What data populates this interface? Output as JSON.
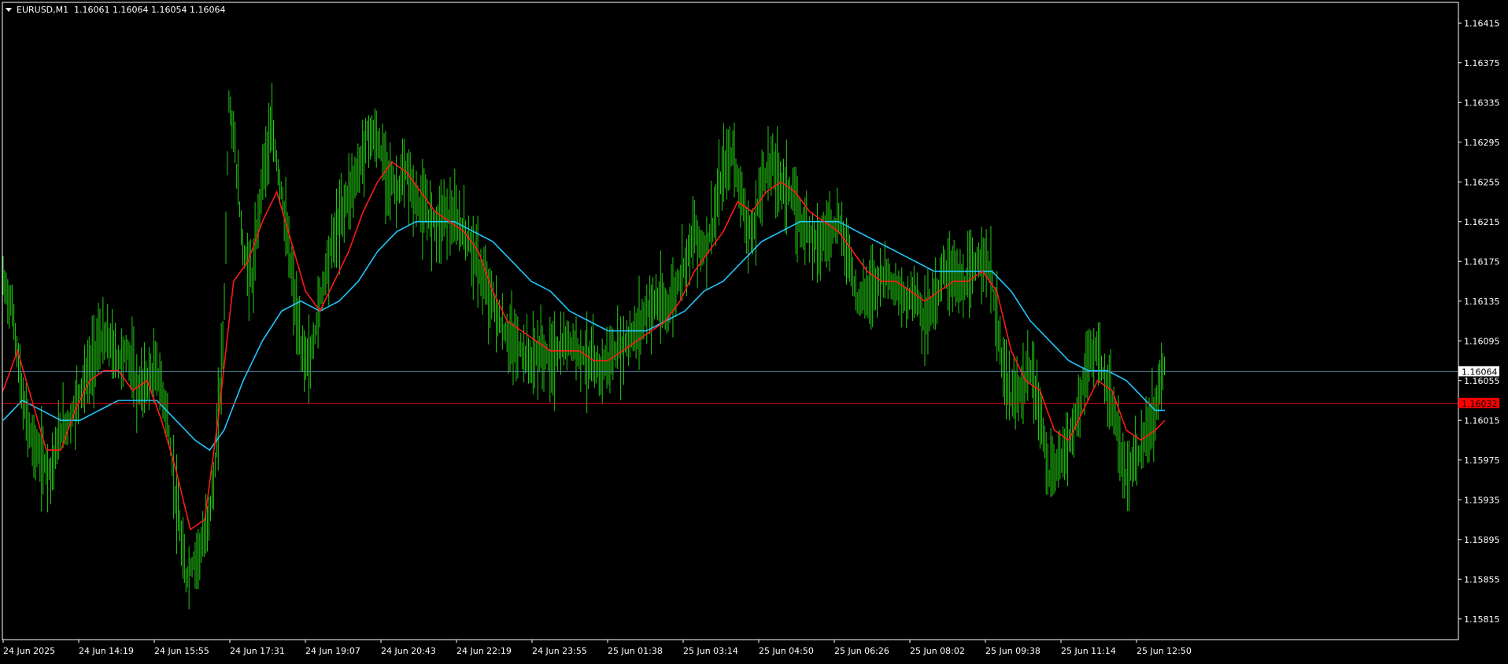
{
  "header": {
    "menu_arrow": "triangle-down-icon",
    "symbol_timeframe": "EURUSD,M1",
    "ohlc": "1.16061 1.16064 1.16054 1.16064"
  },
  "colors": {
    "background": "#000000",
    "frame": "#ffffff",
    "text": "#ffffff",
    "candles": "#22cc11",
    "ma_fast": "#ff1a1a",
    "ma_slow": "#1ec8ff",
    "bid_line": "#5a8ea8",
    "level_line": "#e01010",
    "level_tag": "#ff0000"
  },
  "chart_data": {
    "type": "line",
    "title": "EURUSD,M1",
    "ylim": [
      1.15795,
      1.16435
    ],
    "price_ticks": [
      "1.16415",
      "1.16375",
      "1.16335",
      "1.16295",
      "1.16255",
      "1.16215",
      "1.16175",
      "1.16135",
      "1.16095",
      "1.16055",
      "1.16015",
      "1.15975",
      "1.15935",
      "1.15895",
      "1.15855",
      "1.15815"
    ],
    "time_ticks": [
      "24 Jun 2025",
      "24 Jun 14:19",
      "24 Jun 15:55",
      "24 Jun 17:31",
      "24 Jun 19:07",
      "24 Jun 20:43",
      "24 Jun 22:19",
      "24 Jun 23:55",
      "25 Jun 01:38",
      "25 Jun 03:14",
      "25 Jun 04:50",
      "25 Jun 06:26",
      "25 Jun 08:02",
      "25 Jun 09:38",
      "25 Jun 11:14",
      "25 Jun 12:50"
    ],
    "price_series": [
      [
        0,
        1.16155
      ],
      [
        10,
        1.16125
      ],
      [
        20,
        1.16035
      ],
      [
        30,
        1.15995
      ],
      [
        40,
        1.15975
      ],
      [
        50,
        1.15965
      ],
      [
        60,
        1.16005
      ],
      [
        70,
        1.16015
      ],
      [
        80,
        1.16045
      ],
      [
        90,
        1.16065
      ],
      [
        100,
        1.16095
      ],
      [
        110,
        1.16095
      ],
      [
        120,
        1.16075
      ],
      [
        130,
        1.16085
      ],
      [
        140,
        1.16045
      ],
      [
        150,
        1.16055
      ],
      [
        160,
        1.16065
      ],
      [
        170,
        1.16025
      ],
      [
        180,
        1.15935
      ],
      [
        190,
        1.15855
      ],
      [
        200,
        1.15875
      ],
      [
        210,
        1.15895
      ],
      [
        220,
        1.15955
      ],
      [
        230,
        1.16115
      ],
      [
        235,
        1.16335
      ],
      [
        240,
        1.16305
      ],
      [
        250,
        1.16185
      ],
      [
        260,
        1.16155
      ],
      [
        270,
        1.16265
      ],
      [
        280,
        1.16305
      ],
      [
        290,
        1.16245
      ],
      [
        300,
        1.16165
      ],
      [
        310,
        1.16085
      ],
      [
        320,
        1.16075
      ],
      [
        330,
        1.16135
      ],
      [
        340,
        1.16185
      ],
      [
        350,
        1.16215
      ],
      [
        360,
        1.16245
      ],
      [
        370,
        1.16265
      ],
      [
        380,
        1.16305
      ],
      [
        390,
        1.16295
      ],
      [
        400,
        1.16265
      ],
      [
        410,
        1.16245
      ],
      [
        420,
        1.16265
      ],
      [
        430,
        1.16235
      ],
      [
        440,
        1.16225
      ],
      [
        450,
        1.16215
      ],
      [
        460,
        1.16225
      ],
      [
        470,
        1.16215
      ],
      [
        480,
        1.16205
      ],
      [
        490,
        1.16185
      ],
      [
        500,
        1.16155
      ],
      [
        510,
        1.16135
      ],
      [
        520,
        1.16105
      ],
      [
        530,
        1.16095
      ],
      [
        540,
        1.16085
      ],
      [
        550,
        1.16075
      ],
      [
        560,
        1.16085
      ],
      [
        570,
        1.16075
      ],
      [
        580,
        1.16085
      ],
      [
        590,
        1.16095
      ],
      [
        600,
        1.16085
      ],
      [
        610,
        1.16075
      ],
      [
        620,
        1.16065
      ],
      [
        630,
        1.16075
      ],
      [
        640,
        1.16085
      ],
      [
        650,
        1.16095
      ],
      [
        660,
        1.16105
      ],
      [
        670,
        1.16125
      ],
      [
        680,
        1.16135
      ],
      [
        690,
        1.16125
      ],
      [
        700,
        1.16145
      ],
      [
        710,
        1.16175
      ],
      [
        720,
        1.16205
      ],
      [
        730,
        1.16185
      ],
      [
        740,
        1.16215
      ],
      [
        750,
        1.16265
      ],
      [
        760,
        1.16285
      ],
      [
        770,
        1.16235
      ],
      [
        780,
        1.16195
      ],
      [
        790,
        1.16255
      ],
      [
        800,
        1.16275
      ],
      [
        810,
        1.16255
      ],
      [
        820,
        1.16245
      ],
      [
        830,
        1.16215
      ],
      [
        840,
        1.16205
      ],
      [
        850,
        1.16195
      ],
      [
        860,
        1.16205
      ],
      [
        870,
        1.16215
      ],
      [
        880,
        1.16185
      ],
      [
        890,
        1.16135
      ],
      [
        900,
        1.16145
      ],
      [
        910,
        1.16155
      ],
      [
        920,
        1.16165
      ],
      [
        930,
        1.16145
      ],
      [
        940,
        1.16135
      ],
      [
        950,
        1.16145
      ],
      [
        960,
        1.16115
      ],
      [
        970,
        1.16135
      ],
      [
        980,
        1.16165
      ],
      [
        990,
        1.16165
      ],
      [
        1000,
        1.16145
      ],
      [
        1010,
        1.16165
      ],
      [
        1020,
        1.16185
      ],
      [
        1030,
        1.16155
      ],
      [
        1040,
        1.16075
      ],
      [
        1050,
        1.16035
      ],
      [
        1060,
        1.16045
      ],
      [
        1070,
        1.16065
      ],
      [
        1080,
        1.16025
      ],
      [
        1090,
        1.15955
      ],
      [
        1100,
        1.15975
      ],
      [
        1110,
        1.15995
      ],
      [
        1120,
        1.16025
      ],
      [
        1130,
        1.16075
      ],
      [
        1140,
        1.16085
      ],
      [
        1150,
        1.16045
      ],
      [
        1160,
        1.16005
      ],
      [
        1170,
        1.15955
      ],
      [
        1180,
        1.15975
      ],
      [
        1190,
        1.15995
      ],
      [
        1200,
        1.16025
      ],
      [
        1210,
        1.16075
      ]
    ],
    "ma_fast_series": [
      [
        0,
        1.16045
      ],
      [
        15,
        1.16085
      ],
      [
        30,
        1.16035
      ],
      [
        45,
        1.15985
      ],
      [
        60,
        1.15985
      ],
      [
        75,
        1.16025
      ],
      [
        90,
        1.16055
      ],
      [
        105,
        1.16065
      ],
      [
        120,
        1.16065
      ],
      [
        135,
        1.16045
      ],
      [
        150,
        1.16055
      ],
      [
        165,
        1.16015
      ],
      [
        180,
        1.15965
      ],
      [
        195,
        1.15905
      ],
      [
        210,
        1.15915
      ],
      [
        225,
        1.16025
      ],
      [
        240,
        1.16155
      ],
      [
        255,
        1.16175
      ],
      [
        270,
        1.16215
      ],
      [
        285,
        1.16245
      ],
      [
        300,
        1.16195
      ],
      [
        315,
        1.16145
      ],
      [
        330,
        1.16125
      ],
      [
        345,
        1.16155
      ],
      [
        360,
        1.16185
      ],
      [
        375,
        1.16225
      ],
      [
        390,
        1.16255
      ],
      [
        405,
        1.16275
      ],
      [
        420,
        1.16265
      ],
      [
        435,
        1.16245
      ],
      [
        450,
        1.16225
      ],
      [
        465,
        1.16215
      ],
      [
        480,
        1.16205
      ],
      [
        495,
        1.16185
      ],
      [
        510,
        1.16145
      ],
      [
        525,
        1.16115
      ],
      [
        540,
        1.16105
      ],
      [
        555,
        1.16095
      ],
      [
        570,
        1.16085
      ],
      [
        585,
        1.16085
      ],
      [
        600,
        1.16085
      ],
      [
        615,
        1.16075
      ],
      [
        630,
        1.16075
      ],
      [
        645,
        1.16085
      ],
      [
        660,
        1.16095
      ],
      [
        675,
        1.16105
      ],
      [
        690,
        1.16115
      ],
      [
        705,
        1.16135
      ],
      [
        720,
        1.16165
      ],
      [
        735,
        1.16185
      ],
      [
        750,
        1.16205
      ],
      [
        765,
        1.16235
      ],
      [
        780,
        1.16225
      ],
      [
        795,
        1.16245
      ],
      [
        810,
        1.16255
      ],
      [
        825,
        1.16245
      ],
      [
        840,
        1.16225
      ],
      [
        855,
        1.16215
      ],
      [
        870,
        1.16205
      ],
      [
        885,
        1.16185
      ],
      [
        900,
        1.16165
      ],
      [
        915,
        1.16155
      ],
      [
        930,
        1.16155
      ],
      [
        945,
        1.16145
      ],
      [
        960,
        1.16135
      ],
      [
        975,
        1.16145
      ],
      [
        990,
        1.16155
      ],
      [
        1005,
        1.16155
      ],
      [
        1020,
        1.16165
      ],
      [
        1035,
        1.16145
      ],
      [
        1050,
        1.16085
      ],
      [
        1065,
        1.16055
      ],
      [
        1080,
        1.16045
      ],
      [
        1095,
        1.16005
      ],
      [
        1110,
        1.15995
      ],
      [
        1125,
        1.16025
      ],
      [
        1140,
        1.16055
      ],
      [
        1155,
        1.16045
      ],
      [
        1170,
        1.16005
      ],
      [
        1185,
        1.15995
      ],
      [
        1200,
        1.16005
      ],
      [
        1210,
        1.16015
      ]
    ],
    "ma_slow_series": [
      [
        0,
        1.16015
      ],
      [
        20,
        1.16035
      ],
      [
        40,
        1.16025
      ],
      [
        60,
        1.16015
      ],
      [
        80,
        1.16015
      ],
      [
        100,
        1.16025
      ],
      [
        120,
        1.16035
      ],
      [
        140,
        1.16035
      ],
      [
        160,
        1.16035
      ],
      [
        180,
        1.16015
      ],
      [
        200,
        1.15995
      ],
      [
        215,
        1.15985
      ],
      [
        230,
        1.16005
      ],
      [
        250,
        1.16055
      ],
      [
        270,
        1.16095
      ],
      [
        290,
        1.16125
      ],
      [
        310,
        1.16135
      ],
      [
        330,
        1.16125
      ],
      [
        350,
        1.16135
      ],
      [
        370,
        1.16155
      ],
      [
        390,
        1.16185
      ],
      [
        410,
        1.16205
      ],
      [
        430,
        1.16215
      ],
      [
        450,
        1.16215
      ],
      [
        470,
        1.16215
      ],
      [
        490,
        1.16205
      ],
      [
        510,
        1.16195
      ],
      [
        530,
        1.16175
      ],
      [
        550,
        1.16155
      ],
      [
        570,
        1.16145
      ],
      [
        590,
        1.16125
      ],
      [
        610,
        1.16115
      ],
      [
        630,
        1.16105
      ],
      [
        650,
        1.16105
      ],
      [
        670,
        1.16105
      ],
      [
        690,
        1.16115
      ],
      [
        710,
        1.16125
      ],
      [
        730,
        1.16145
      ],
      [
        750,
        1.16155
      ],
      [
        770,
        1.16175
      ],
      [
        790,
        1.16195
      ],
      [
        810,
        1.16205
      ],
      [
        830,
        1.16215
      ],
      [
        850,
        1.16215
      ],
      [
        870,
        1.16215
      ],
      [
        890,
        1.16205
      ],
      [
        910,
        1.16195
      ],
      [
        930,
        1.16185
      ],
      [
        950,
        1.16175
      ],
      [
        970,
        1.16165
      ],
      [
        990,
        1.16165
      ],
      [
        1010,
        1.16165
      ],
      [
        1030,
        1.16165
      ],
      [
        1050,
        1.16145
      ],
      [
        1070,
        1.16115
      ],
      [
        1090,
        1.16095
      ],
      [
        1110,
        1.16075
      ],
      [
        1130,
        1.16065
      ],
      [
        1150,
        1.16065
      ],
      [
        1170,
        1.16055
      ],
      [
        1190,
        1.16035
      ],
      [
        1200,
        1.16025
      ],
      [
        1210,
        1.16025
      ]
    ]
  },
  "axis_tags": {
    "bid_price": "1.16064",
    "level_price": "1.16032"
  }
}
